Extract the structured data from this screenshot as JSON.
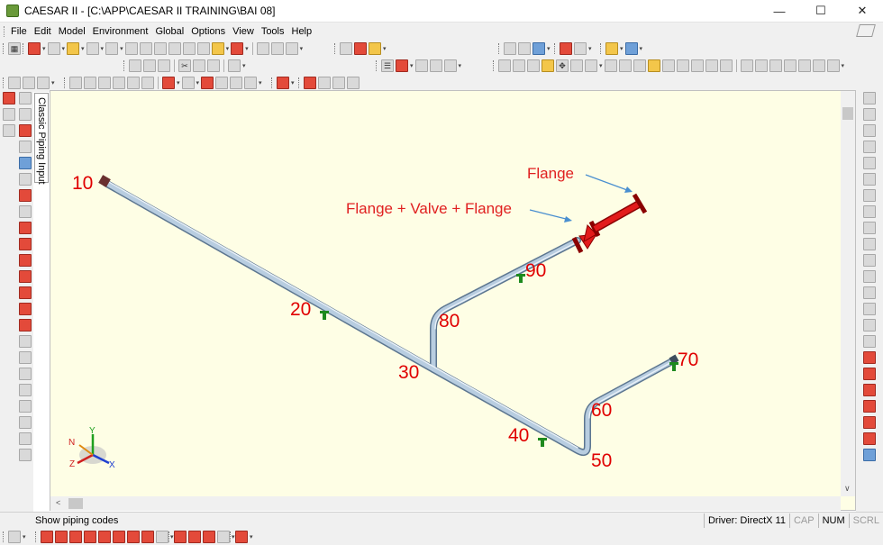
{
  "window": {
    "title": "CAESAR II - [C:\\APP\\CAESAR II TRAINING\\BAI 08]",
    "minimize": "—",
    "maximize": "☐",
    "close": "✕"
  },
  "menu": [
    "File",
    "Edit",
    "Model",
    "Environment",
    "Global",
    "Options",
    "View",
    "Tools",
    "Help"
  ],
  "side_tab": {
    "label": "Classic Piping Input"
  },
  "model": {
    "nodes": [
      "10",
      "20",
      "30",
      "40",
      "50",
      "60",
      "70",
      "80",
      "90"
    ],
    "annotations": {
      "flange": "Flange",
      "flange_valve_flange": "Flange + Valve + Flange"
    },
    "colors": {
      "pipe": "#a9c2d9",
      "pipe_edge": "#5c7690",
      "valve": "#e21b1b",
      "node_label": "#e00000",
      "support": "#1e8a1e",
      "background": "#fefee5"
    }
  },
  "axes": {
    "x": "X",
    "y": "Y",
    "z": "Z",
    "n": "N"
  },
  "status": {
    "message": "Show piping codes",
    "driver": "Driver: DirectX 11",
    "cap": "CAP",
    "num": "NUM",
    "scrl": "SCRL"
  },
  "scroll": {
    "left": "<",
    "down": "∨"
  }
}
